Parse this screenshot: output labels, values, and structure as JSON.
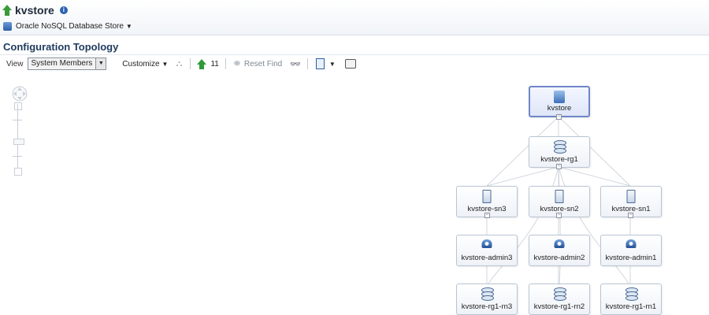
{
  "header": {
    "app_title": "kvstore",
    "target_label": "Oracle NoSQL Database Store"
  },
  "section": {
    "title": "Configuration Topology"
  },
  "toolbar": {
    "view_label": "View",
    "view_selected": "System Members",
    "customize_label": "Customize",
    "up_count": "11",
    "reset_find_label": "Reset Find"
  },
  "topology": {
    "nodes": [
      {
        "id": "store",
        "label": "kvstore",
        "type": "store",
        "selected": true
      },
      {
        "id": "rg1",
        "label": "kvstore-rg1",
        "type": "replication-group"
      },
      {
        "id": "sn3",
        "label": "kvstore-sn3",
        "type": "storage-node"
      },
      {
        "id": "sn2",
        "label": "kvstore-sn2",
        "type": "storage-node"
      },
      {
        "id": "sn1",
        "label": "kvstore-sn1",
        "type": "storage-node"
      },
      {
        "id": "admin3",
        "label": "kvstore-admin3",
        "type": "admin"
      },
      {
        "id": "admin2",
        "label": "kvstore-admin2",
        "type": "admin"
      },
      {
        "id": "admin1",
        "label": "kvstore-admin1",
        "type": "admin"
      },
      {
        "id": "rn3",
        "label": "kvstore-rg1-rn3",
        "type": "replication-node"
      },
      {
        "id": "rn2",
        "label": "kvstore-rg1-rn2",
        "type": "replication-node"
      },
      {
        "id": "rn1",
        "label": "kvstore-rg1-rn1",
        "type": "replication-node"
      }
    ]
  },
  "colors": {
    "accent": "#2a62b3",
    "selected_border": "#6f86c8",
    "edge": "#d2d7de",
    "up_arrow": "#2f9a3a"
  }
}
